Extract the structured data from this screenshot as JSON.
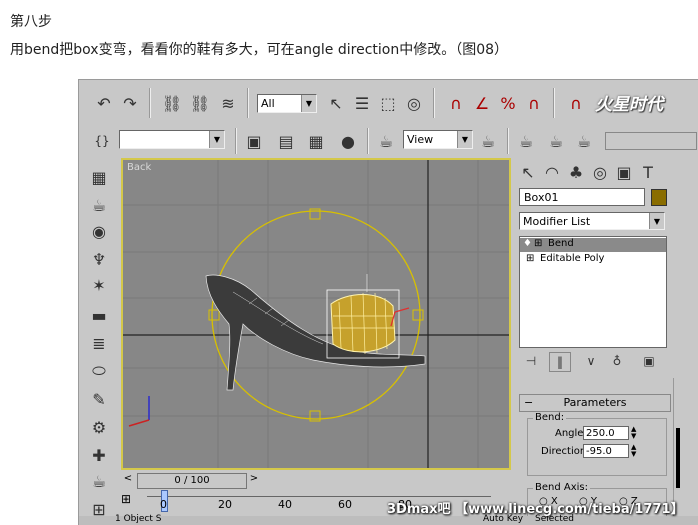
{
  "article": {
    "step_title": "第八步",
    "description": "用bend把box变弯，看看你的鞋有多大，可在angle direction中修改。（图08）"
  },
  "toolbar": {
    "selection_filter": "All",
    "view_dropdown": "View",
    "logo": "火星时代"
  },
  "viewport": {
    "label": "Back"
  },
  "command_panel": {
    "object_name": "Box01",
    "object_color": "#8a6d00",
    "modifier_list": "Modifier List",
    "stack": [
      "Bend",
      "Editable Poly"
    ],
    "rollout_title": "Parameters",
    "bend_group": "Bend:",
    "angle_label": "Angle:",
    "angle_value": "250.0",
    "direction_label": "Direction:",
    "direction_value": "-95.0",
    "bend_axis_group": "Bend Axis:",
    "axes": [
      "X",
      "Y",
      "Z"
    ]
  },
  "timeline": {
    "frame": "0 / 100",
    "ticks": [
      "0",
      "20",
      "40",
      "60",
      "80"
    ]
  },
  "status": {
    "objects": "1 Object S",
    "auto_key": "Auto Key",
    "selected": "Selected"
  },
  "watermark": "3Dmax吧 【www.linecg.com/tieba/1771】"
}
